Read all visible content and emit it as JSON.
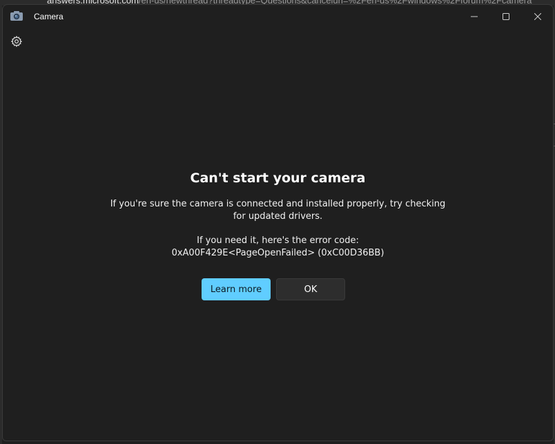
{
  "background_browser": {
    "url_host": "answers.microsoft.com",
    "url_path": "/en-us/newthread?threadtype=Questions&cancelurl=%2Fen-us%2Fwindows%2Fforum%2Fcamera"
  },
  "window": {
    "title": "Camera",
    "icon": "camera-icon",
    "controls": {
      "minimize": "minimize-icon",
      "maximize": "maximize-icon",
      "close": "close-icon"
    }
  },
  "toolbar": {
    "settings_icon": "gear-icon"
  },
  "dialog": {
    "title": "Can't start your camera",
    "message": "If you're sure the camera is connected and installed properly, try checking for updated drivers.",
    "error_label": "If you need it, here's the error code:",
    "error_code": "0xA00F429E<PageOpenFailed> (0xC00D36BB)",
    "learn_more_label": "Learn more",
    "ok_label": "OK"
  },
  "colors": {
    "background": "#1f1f1f",
    "accent": "#60cdff",
    "secondary_button": "#2d2d2d"
  }
}
